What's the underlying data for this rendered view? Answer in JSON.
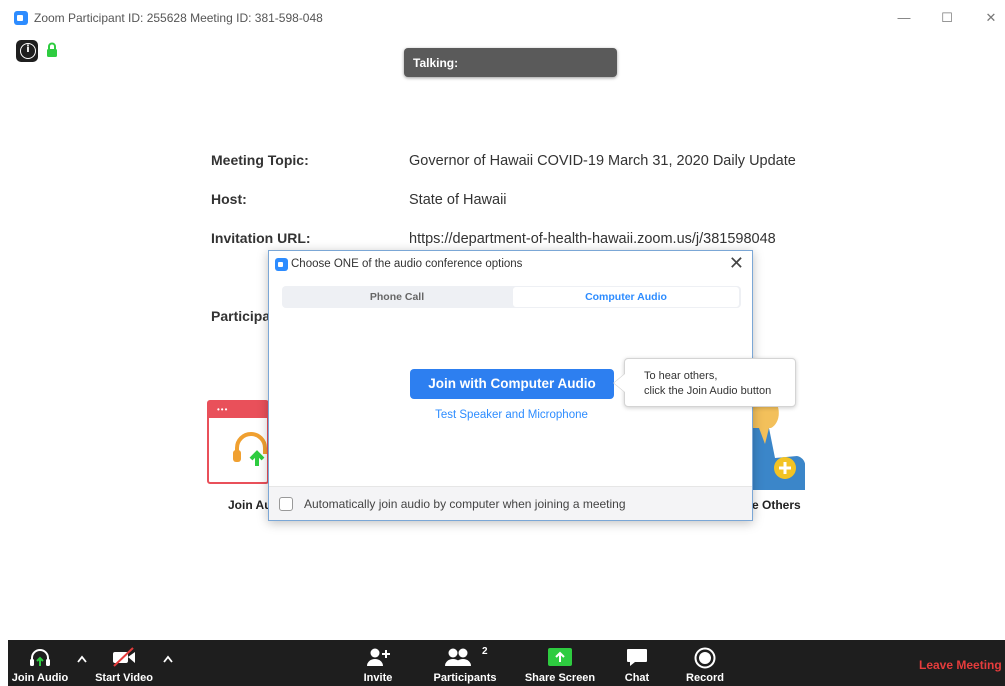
{
  "window": {
    "title": "Zoom Participant ID: 255628   Meeting ID: 381-598-048",
    "controls": {
      "minimize": "—",
      "maximize": "☐",
      "close": "✕"
    }
  },
  "banner": {
    "talking_label": "Talking:"
  },
  "meeting": {
    "topic_label": "Meeting Topic:",
    "topic_value": "Governor of Hawaii COVID-19 March 31, 2020 Daily Update",
    "host_label": "Host:",
    "host_value": "State of Hawaii",
    "url_label": "Invitation URL:",
    "url_value": "https://department-of-health-hawaii.zoom.us/j/381598048",
    "participants_label": "Participa"
  },
  "background_cards": {
    "join_audio_label": "Join Au",
    "invite_others_label": "e Others"
  },
  "dialog": {
    "title": "Choose ONE of the audio conference options",
    "close": "✕",
    "tabs": [
      {
        "label": "Phone Call",
        "active": false
      },
      {
        "label": "Computer Audio",
        "active": true
      }
    ],
    "join_button": "Join with Computer Audio",
    "test_link": "Test Speaker and Microphone",
    "auto_join_label": "Automatically join audio by computer when joining a meeting",
    "auto_join_checked": false
  },
  "tooltip": {
    "line1": "To hear others,",
    "line2": "click the Join Audio button"
  },
  "toolbar": {
    "join_audio": "Join Audio",
    "start_video": "Start Video",
    "invite": "Invite",
    "participants": "Participants",
    "participants_count": "2",
    "share_screen": "Share Screen",
    "chat": "Chat",
    "record": "Record",
    "leave": "Leave Meeting"
  },
  "colors": {
    "accent": "#2D8CFF",
    "toolbar_bg": "#1e1e1e",
    "leave_red": "#e53c3c",
    "share_green": "#2ecc40",
    "join_card_red": "#e9505a"
  }
}
